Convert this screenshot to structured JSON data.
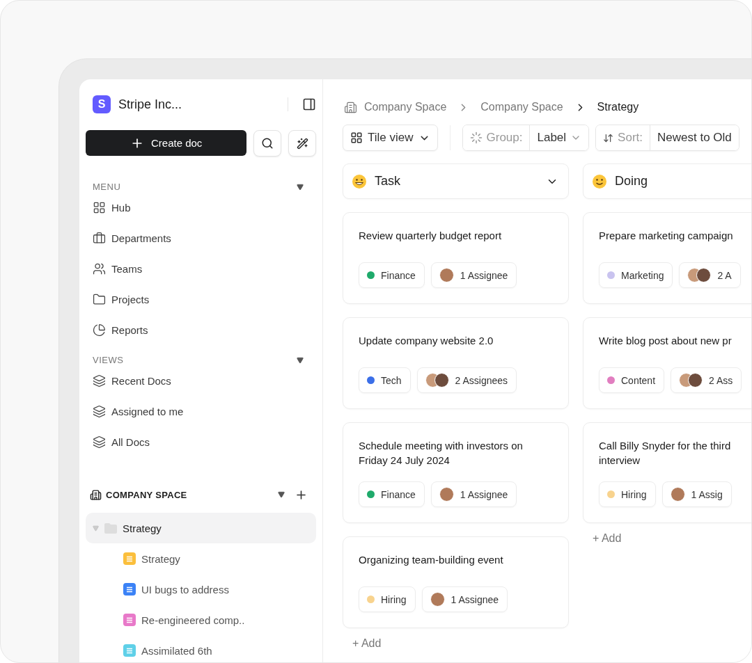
{
  "workspace": {
    "initial": "S",
    "name": "Stripe Inc..."
  },
  "create_button": "Create doc",
  "menu": {
    "title": "MENU",
    "items": [
      {
        "label": "Hub"
      },
      {
        "label": "Departments"
      },
      {
        "label": "Teams"
      },
      {
        "label": "Projects"
      },
      {
        "label": "Reports"
      }
    ]
  },
  "views": {
    "title": "VIEWS",
    "items": [
      {
        "label": "Recent Docs"
      },
      {
        "label": "Assigned to me"
      },
      {
        "label": "All Docs"
      }
    ]
  },
  "company_space": {
    "title": "COMPANY SPACE",
    "tree": [
      {
        "label": "Strategy",
        "expanded": true,
        "selected": true,
        "children": [
          {
            "label": "Strategy",
            "color": "#fbbf3c"
          },
          {
            "label": "UI bugs to address",
            "color": "#3b82f6"
          },
          {
            "label": "Re-engineered comp..",
            "color": "#e879c9"
          },
          {
            "label": "Assimilated 6th",
            "color": "#5fd0e8"
          }
        ]
      }
    ]
  },
  "breadcrumb": [
    "Company Space",
    "Company Space",
    "Strategy"
  ],
  "toolbar": {
    "view": "Tile view",
    "group_label": "Group:",
    "group_value": "Label",
    "sort_label": "Sort:",
    "sort_value": "Newest to Old"
  },
  "columns": [
    {
      "title": "Task",
      "add": "+ Add",
      "cards": [
        {
          "title": "Review quarterly budget report",
          "tag": {
            "label": "Finance",
            "color": "#1faa6b"
          },
          "assignees": {
            "label": "1 Assignee",
            "kind": "single"
          }
        },
        {
          "title": "Update company website 2.0",
          "tag": {
            "label": "Tech",
            "color": "#3b6fe8"
          },
          "assignees": {
            "label": "2 Assignees",
            "kind": "pair"
          }
        },
        {
          "title": "Schedule meeting with investors on Friday 24 July 2024",
          "tag": {
            "label": "Finance",
            "color": "#1faa6b"
          },
          "assignees": {
            "label": "1 Assignee",
            "kind": "single"
          }
        },
        {
          "title": "Organizing team-building event",
          "tag": {
            "label": "Hiring",
            "color": "#f8d38e"
          },
          "assignees": {
            "label": "1 Assignee",
            "kind": "single"
          }
        }
      ]
    },
    {
      "title": "Doing",
      "add": "+ Add",
      "cards": [
        {
          "title": "Prepare marketing campaign",
          "tag": {
            "label": "Marketing",
            "color": "#c9c3ef"
          },
          "assignees": {
            "label": "2 A",
            "kind": "pair"
          }
        },
        {
          "title": "Write blog post about new pr",
          "tag": {
            "label": "Content",
            "color": "#e17ec0"
          },
          "assignees": {
            "label": "2 Ass",
            "kind": "pair"
          }
        },
        {
          "title": "Call Billy Snyder for the third interview",
          "tag": {
            "label": "Hiring",
            "color": "#f8d38e"
          },
          "assignees": {
            "label": "1 Assig",
            "kind": "single"
          }
        }
      ]
    }
  ]
}
